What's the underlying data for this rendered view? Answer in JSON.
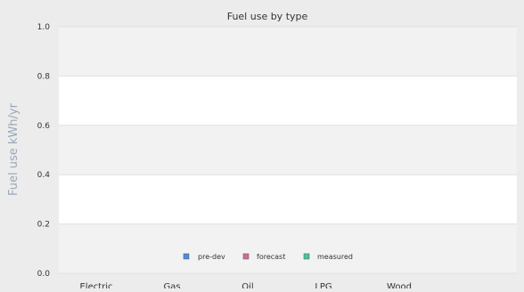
{
  "chart_data": {
    "type": "bar",
    "title": "Fuel use by type",
    "xlabel": "",
    "ylabel": "Fuel use  kWh/yr",
    "categories": [
      "Electric",
      "Gas",
      "Oil",
      "LPG",
      "Wood"
    ],
    "series": [
      {
        "name": "pre-dev",
        "values": [
          0,
          0,
          0,
          0,
          0
        ],
        "color": "#4a90d9"
      },
      {
        "name": "forecast",
        "values": [
          0,
          0,
          0,
          0,
          0
        ],
        "color": "#d46a9a"
      },
      {
        "name": "measured",
        "values": [
          0,
          0,
          0,
          0,
          0
        ],
        "color": "#45c7a0"
      }
    ],
    "ylim": [
      0,
      1
    ],
    "yticks": [
      "0.0",
      "0.2",
      "0.4",
      "0.6",
      "0.8",
      "1.0"
    ],
    "grid": true,
    "legend_position": "bottom-center"
  },
  "colors": {
    "page_background": "#ececec",
    "band_light": "#ffffff",
    "band_dark": "#f2f2f2",
    "gridline": "#e0e0e0",
    "text": "#333333",
    "ylabel": "#9aa7b8"
  }
}
